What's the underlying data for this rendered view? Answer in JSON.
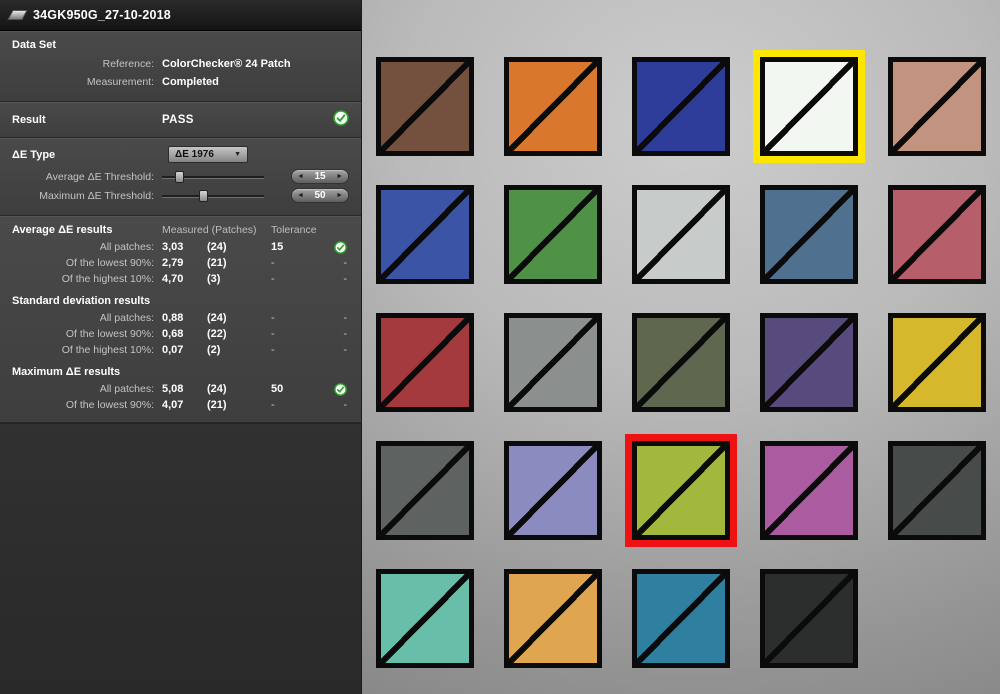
{
  "window": {
    "title": "34GK950G_27-10-2018"
  },
  "data_set": {
    "header": "Data Set",
    "reference_label": "Reference:",
    "reference_value": "ColorChecker® 24 Patch",
    "measurement_label": "Measurement:",
    "measurement_value": "Completed"
  },
  "result": {
    "label": "Result",
    "value": "PASS",
    "status": "pass"
  },
  "de_type": {
    "label": "ΔE Type",
    "selected": "ΔE 1976"
  },
  "thresholds": {
    "average": {
      "label": "Average  ΔE Threshold:",
      "value": "15",
      "slider_percent": 17
    },
    "maximum": {
      "label": "Maximum ΔE Threshold:",
      "value": "50",
      "slider_percent": 40
    }
  },
  "results_table": {
    "col_measured": "Measured (Patches)",
    "col_tolerance": "Tolerance",
    "sections": [
      {
        "header": "Average ΔE results",
        "rows": [
          {
            "label": "All patches:",
            "measured": "3,03",
            "patches": "(24)",
            "tolerance": "15",
            "check": "ok"
          },
          {
            "label": "Of the lowest 90%:",
            "measured": "2,79",
            "patches": "(21)",
            "tolerance": "-",
            "check": "-"
          },
          {
            "label": "Of the highest 10%:",
            "measured": "4,70",
            "patches": "(3)",
            "tolerance": "-",
            "check": "-"
          }
        ]
      },
      {
        "header": "Standard deviation results",
        "rows": [
          {
            "label": "All patches:",
            "measured": "0,88",
            "patches": "(24)",
            "tolerance": "-",
            "check": "-"
          },
          {
            "label": "Of the lowest 90%:",
            "measured": "0,68",
            "patches": "(22)",
            "tolerance": "-",
            "check": "-"
          },
          {
            "label": "Of the highest 10%:",
            "measured": "0,07",
            "patches": "(2)",
            "tolerance": "-",
            "check": "-"
          }
        ]
      },
      {
        "header": "Maximum ΔE results",
        "rows": [
          {
            "label": "All patches:",
            "measured": "5,08",
            "patches": "(24)",
            "tolerance": "50",
            "check": "ok"
          },
          {
            "label": "Of the lowest 90%:",
            "measured": "4,07",
            "patches": "(21)",
            "tolerance": "-",
            "check": "-"
          }
        ]
      }
    ]
  },
  "icons": {
    "dropdown_arrow": "▼",
    "spinner_left": "◄",
    "spinner_right": "►"
  },
  "colors": {
    "pass_green": "#2f9e2f",
    "highlight_yellow": "#ffe600",
    "highlight_red": "#ee1212"
  },
  "patch_grid": {
    "cols": 5,
    "patches": [
      {
        "color": "#74513E"
      },
      {
        "color": "#D9782D"
      },
      {
        "color": "#2E3D9A"
      },
      {
        "color": "#F2F7F2",
        "highlight": "yellow"
      },
      {
        "color": "#C2937F"
      },
      {
        "color": "#3B54A5"
      },
      {
        "color": "#4E9147"
      },
      {
        "color": "#C7CCCA"
      },
      {
        "color": "#50708F"
      },
      {
        "color": "#B65E69"
      },
      {
        "color": "#A43A3D"
      },
      {
        "color": "#8B908E"
      },
      {
        "color": "#5E684F"
      },
      {
        "color": "#584A7C"
      },
      {
        "color": "#D5B82B"
      },
      {
        "color": "#5E6362"
      },
      {
        "color": "#8B8BC0"
      },
      {
        "color": "#A2B83C",
        "highlight": "red"
      },
      {
        "color": "#AB5CA0"
      },
      {
        "color": "#474B4A"
      },
      {
        "color": "#68BEA8"
      },
      {
        "color": "#DFA64F"
      },
      {
        "color": "#2F80A0"
      },
      {
        "color": "#2B2E2D"
      }
    ]
  }
}
